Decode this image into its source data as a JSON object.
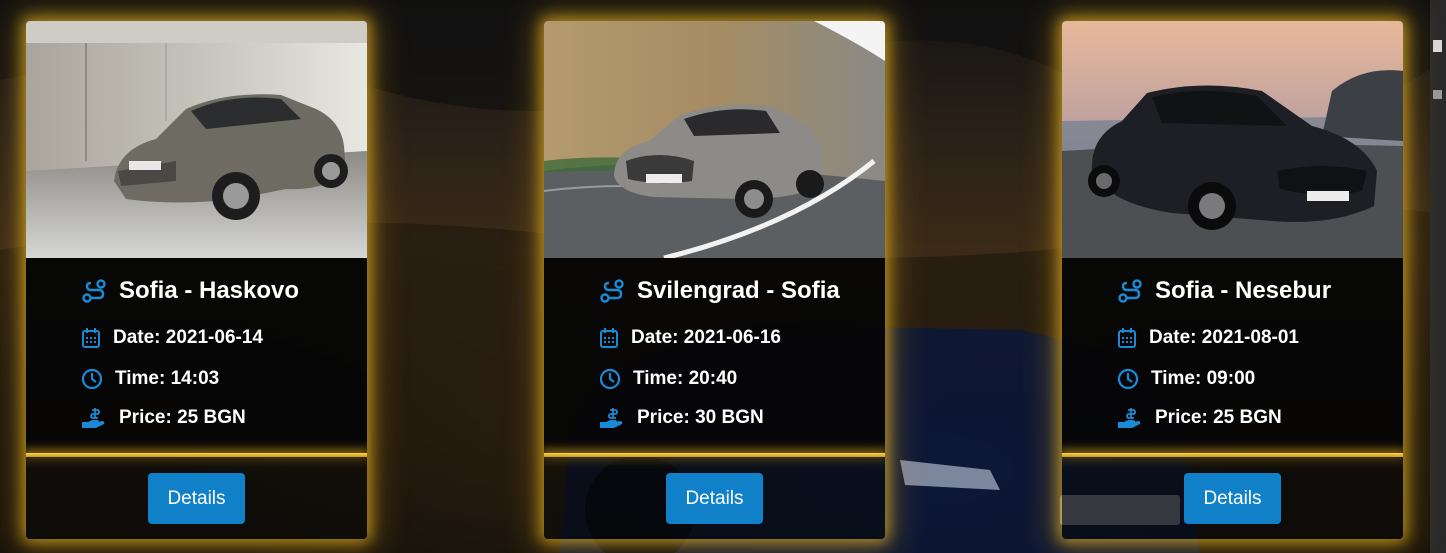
{
  "colors": {
    "accent": "#1080c8",
    "glow": "#ffc828",
    "card_bg": "#050505",
    "text": "#ffffff"
  },
  "icons": {
    "route": "route-icon",
    "date": "calendar-icon",
    "time": "clock-icon",
    "price": "hand-coin-icon"
  },
  "cards": [
    {
      "route": "Sofia - Haskovo",
      "date_label": "Date: 2021-06-14",
      "time_label": "Time: 14:03",
      "price_label": "Price: 25 BGN",
      "button_label": "Details",
      "image": "grey-audi-a5-sportback"
    },
    {
      "route": "Svilengrad - Sofia",
      "date_label": "Date: 2021-06-16",
      "time_label": "Time: 20:40",
      "price_label": "Price: 30 BGN",
      "button_label": "Details",
      "image": "silver-mercedes-cls-on-road"
    },
    {
      "route": "Sofia - Nesebur",
      "date_label": "Date: 2021-08-01",
      "time_label": "Time: 09:00",
      "price_label": "Price: 25 BGN",
      "button_label": "Details",
      "image": "black-mercedes-cls-coast"
    }
  ]
}
